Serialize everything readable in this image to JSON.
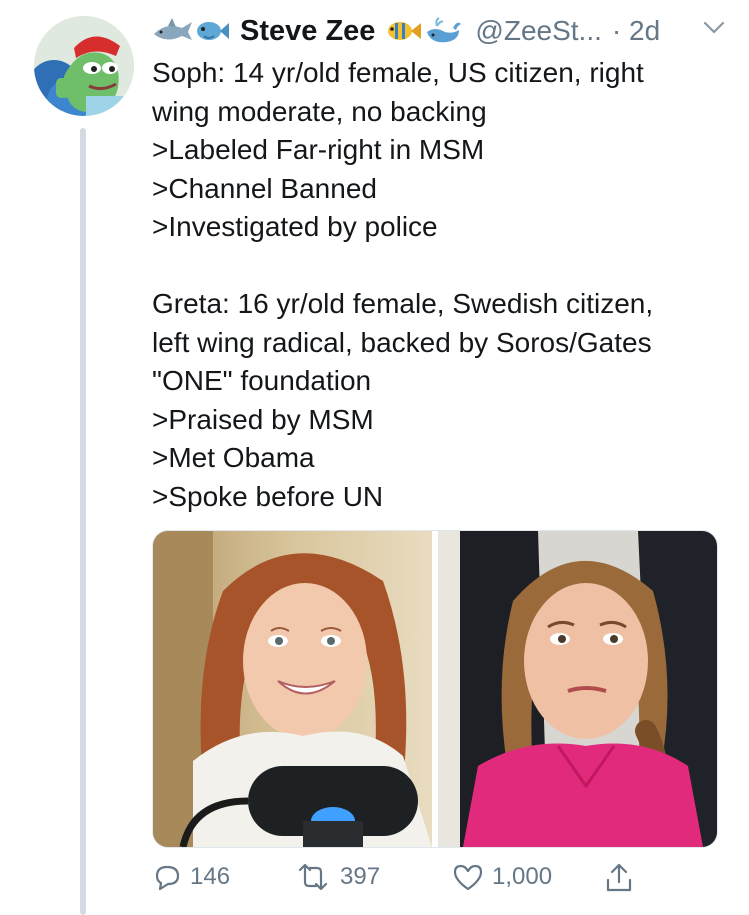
{
  "tweet": {
    "display_name": "Steve Zee",
    "handle": "@ZeeSt...",
    "time": "· 2d",
    "lines": [
      "Soph: 14 yr/old female, US citizen, right",
      "wing moderate, no backing",
      ">Labeled Far-right in MSM",
      ">Channel Banned",
      ">Investigated by police",
      "",
      "Greta: 16 yr/old female, Swedish citizen,",
      "left wing radical, backed by Soros/Gates",
      "\"ONE\" foundation",
      ">Praised by MSM",
      ">Met Obama",
      ">Spoke before UN"
    ],
    "replies": "146",
    "retweets": "397",
    "likes": "1,000"
  },
  "icons": {
    "caret": "chevron-down-icon",
    "reply": "reply-icon",
    "retweet": "retweet-icon",
    "like": "heart-icon",
    "share": "share-icon"
  },
  "colors": {
    "text": "#14171a",
    "secondary": "#657786",
    "thread_line": "#d2dbe3"
  }
}
